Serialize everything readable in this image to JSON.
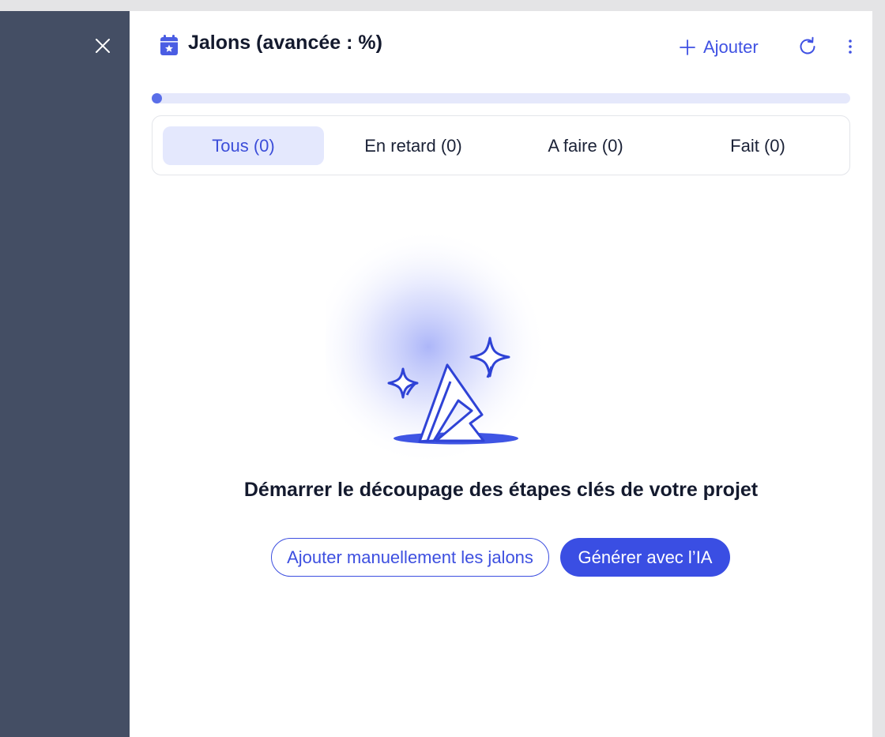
{
  "header": {
    "title": "Jalons (avancée : %)",
    "add_label": "Ajouter",
    "icon": "calendar-star-icon"
  },
  "progress": {
    "value": 0
  },
  "tabs": [
    {
      "label": "Tous (0)",
      "active": true
    },
    {
      "label": "En retard (0)",
      "active": false
    },
    {
      "label": "A faire (0)",
      "active": false
    },
    {
      "label": "Fait (0)",
      "active": false
    }
  ],
  "empty_state": {
    "title": "Démarrer le découpage des étapes clés de votre projet",
    "manual_button": "Ajouter manuellement les jalons",
    "ai_button": "Générer avec l’IA"
  },
  "colors": {
    "accent": "#3a4ee3",
    "sidebar": "#444e64",
    "tab_active_bg": "#e4e8fd",
    "progress_track": "#e5e8fb"
  }
}
